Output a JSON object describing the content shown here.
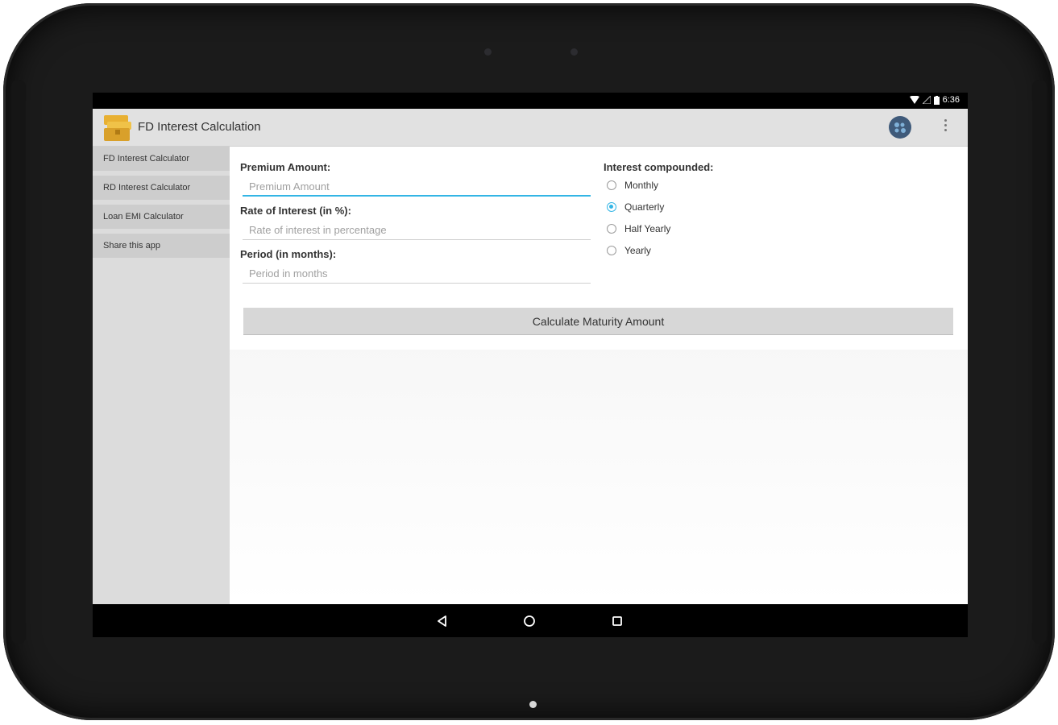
{
  "status_bar": {
    "time": "6:36",
    "icons": [
      "wifi-icon",
      "signal-icon",
      "battery-icon"
    ]
  },
  "app_bar": {
    "title": "FD Interest Calculation",
    "logo_icon": "treasure-chest-icon",
    "actions": [
      "globe-icon",
      "overflow-menu-icon"
    ]
  },
  "sidebar": {
    "items": [
      {
        "label": "FD Interest Calculator"
      },
      {
        "label": "RD Interest Calculator"
      },
      {
        "label": "Loan EMI Calculator"
      },
      {
        "label": "Share this app"
      }
    ]
  },
  "form": {
    "premium": {
      "label": "Premium Amount:",
      "placeholder": "Premium Amount",
      "value": ""
    },
    "rate": {
      "label": "Rate of Interest (in %):",
      "placeholder": "Rate of interest in percentage",
      "value": ""
    },
    "period": {
      "label": "Period (in months):",
      "placeholder": "Period in months",
      "value": ""
    },
    "compounding": {
      "label": "Interest compounded:",
      "options": [
        "Monthly",
        "Quarterly",
        "Half Yearly",
        "Yearly"
      ],
      "selected": "Quarterly"
    },
    "calculate_button": "Calculate Maturity Amount"
  },
  "nav_bar": {
    "buttons": [
      "back-icon",
      "home-icon",
      "recents-icon"
    ]
  },
  "colors": {
    "accent": "#33b5e5",
    "app_bar": "#e1e1e1",
    "sidebar": "#dcdcdc",
    "device": "#1b1b1b"
  }
}
